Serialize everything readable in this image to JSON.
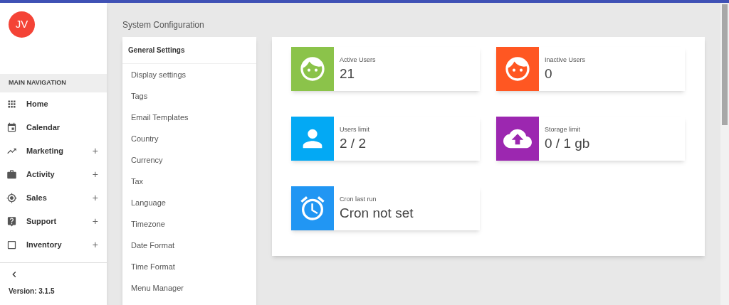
{
  "sidebar": {
    "avatar": "JV",
    "section_title": "MAIN NAVIGATION",
    "items": [
      {
        "label": "Home",
        "kind": "apps"
      },
      {
        "label": "Calendar",
        "kind": "event"
      },
      {
        "label": "Marketing",
        "kind": "trend",
        "toggle": "+"
      },
      {
        "label": "Activity",
        "kind": "work",
        "toggle": "+"
      },
      {
        "label": "Sales",
        "kind": "target",
        "toggle": "+"
      },
      {
        "label": "Support",
        "kind": "help",
        "toggle": "+"
      },
      {
        "label": "Inventory",
        "kind": "box",
        "toggle": "+"
      }
    ],
    "version": "Version: 3.1.5"
  },
  "page_title": "System Configuration",
  "settings_menu": {
    "title": "General Settings",
    "items": [
      "Display settings",
      "Tags",
      "Email Templates",
      "Country",
      "Currency",
      "Tax",
      "Language",
      "Timezone",
      "Date Format",
      "Time Format",
      "Menu Manager"
    ]
  },
  "stats": [
    {
      "label": "Active Users",
      "value": "21",
      "kind": "face",
      "color": "#8bc34a"
    },
    {
      "label": "Inactive Users",
      "value": "0",
      "kind": "face",
      "color": "#ff5722"
    },
    {
      "label": "Users limit",
      "value": "2 / 2",
      "kind": "person",
      "color": "#03a9f4"
    },
    {
      "label": "Storage limit",
      "value": "0 / 1 gb",
      "kind": "cloud",
      "color": "#9c27b0"
    },
    {
      "label": "Cron last run",
      "value": "Cron not set",
      "kind": "alarm",
      "color": "#2196f3"
    }
  ]
}
